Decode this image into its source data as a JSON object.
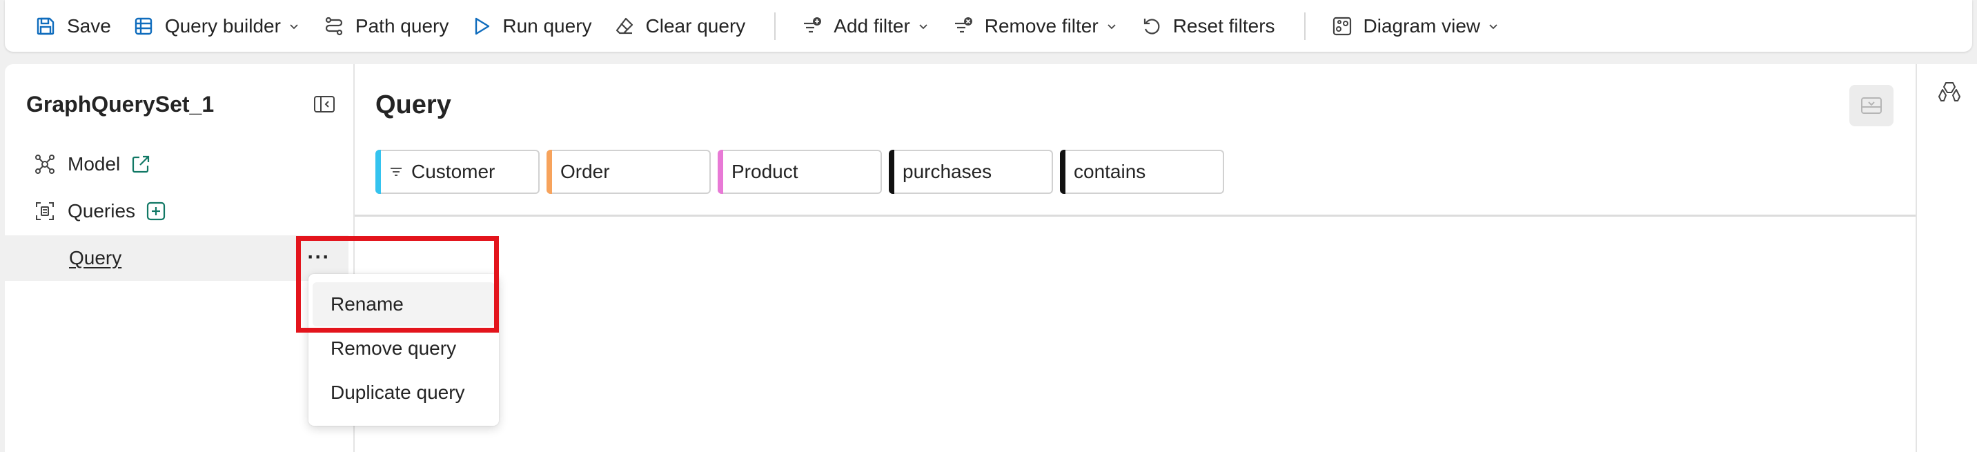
{
  "toolbar": {
    "save": "Save",
    "query_builder": "Query builder",
    "path_query": "Path query",
    "run_query": "Run query",
    "clear_query": "Clear query",
    "add_filter": "Add filter",
    "remove_filter": "Remove filter",
    "reset_filters": "Reset filters",
    "diagram_view": "Diagram view"
  },
  "left_pane": {
    "title": "GraphQuerySet_1",
    "items": {
      "model": "Model",
      "queries": "Queries",
      "query": "Query"
    },
    "more_label": "···"
  },
  "main": {
    "title": "Query",
    "chips": [
      {
        "label": "Customer",
        "color": "#34c3ef",
        "filtered": true
      },
      {
        "label": "Order",
        "color": "#f7a35c",
        "filtered": false
      },
      {
        "label": "Product",
        "color": "#e879d6",
        "filtered": false
      },
      {
        "label": "purchases",
        "color": "#111111",
        "filtered": false
      },
      {
        "label": "contains",
        "color": "#111111",
        "filtered": false
      }
    ]
  },
  "context_menu": {
    "items": [
      "Rename",
      "Remove query",
      "Duplicate query"
    ],
    "highlighted": "Rename"
  },
  "colors": {
    "accent": "#0f6cbd",
    "highlight_border": "#e3141c",
    "add_icon": "#117865"
  }
}
